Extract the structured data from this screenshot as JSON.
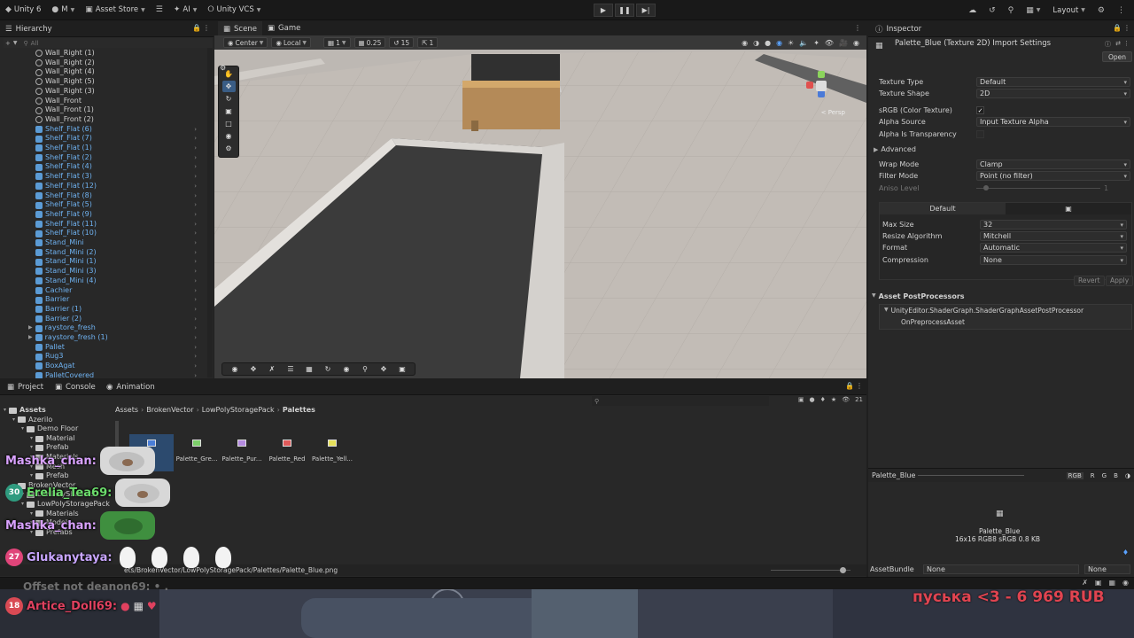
{
  "topbar": {
    "account": "Unity 6",
    "menu_m": "M",
    "asset_store": "Asset Store",
    "ai": "AI",
    "vcs": "Unity VCS",
    "layout": "Layout"
  },
  "hierarchy": {
    "tab": "Hierarchy",
    "search_placeholder": "All",
    "items": [
      {
        "label": "Wall_Right (1)",
        "kind": "grey"
      },
      {
        "label": "Wall_Right (2)",
        "kind": "grey"
      },
      {
        "label": "Wall_Right (4)",
        "kind": "grey"
      },
      {
        "label": "Wall_Right (5)",
        "kind": "grey"
      },
      {
        "label": "Wall_Right (3)",
        "kind": "grey"
      },
      {
        "label": "Wall_Front",
        "kind": "grey"
      },
      {
        "label": "Wall_Front (1)",
        "kind": "grey"
      },
      {
        "label": "Wall_Front (2)",
        "kind": "grey"
      },
      {
        "label": "Shelf_Flat (6)",
        "kind": "blue"
      },
      {
        "label": "Shelf_Flat (7)",
        "kind": "blue"
      },
      {
        "label": "Shelf_Flat (1)",
        "kind": "blue"
      },
      {
        "label": "Shelf_Flat (2)",
        "kind": "blue"
      },
      {
        "label": "Shelf_Flat (4)",
        "kind": "blue"
      },
      {
        "label": "Shelf_Flat (3)",
        "kind": "blue"
      },
      {
        "label": "Shelf_Flat (12)",
        "kind": "blue"
      },
      {
        "label": "Shelf_Flat (8)",
        "kind": "blue"
      },
      {
        "label": "Shelf_Flat (5)",
        "kind": "blue"
      },
      {
        "label": "Shelf_Flat (9)",
        "kind": "blue"
      },
      {
        "label": "Shelf_Flat (11)",
        "kind": "blue"
      },
      {
        "label": "Shelf_Flat (10)",
        "kind": "blue"
      },
      {
        "label": "Stand_Mini",
        "kind": "blue"
      },
      {
        "label": "Stand_Mini (2)",
        "kind": "blue"
      },
      {
        "label": "Stand_Mini (1)",
        "kind": "blue"
      },
      {
        "label": "Stand_Mini (3)",
        "kind": "blue"
      },
      {
        "label": "Stand_Mini (4)",
        "kind": "blue"
      },
      {
        "label": "Cachier",
        "kind": "blue"
      },
      {
        "label": "Barrier",
        "kind": "blue"
      },
      {
        "label": "Barrier (1)",
        "kind": "blue"
      },
      {
        "label": "Barrier (2)",
        "kind": "blue"
      },
      {
        "label": "raystore_fresh",
        "kind": "blue"
      },
      {
        "label": "raystore_fresh (1)",
        "kind": "blue"
      },
      {
        "label": "Pallet",
        "kind": "blue"
      },
      {
        "label": "Rug3",
        "kind": "blue"
      },
      {
        "label": "BoxAgat",
        "kind": "blue"
      },
      {
        "label": "PalletCovered",
        "kind": "blue"
      }
    ]
  },
  "scene": {
    "tab_scene": "Scene",
    "tab_game": "Game",
    "pivot": "Center",
    "space": "Local",
    "grid_value": "1",
    "snap_value": "0.25",
    "rot_snap": "15",
    "scale_snap": "1",
    "gizmo_label": "< Persp"
  },
  "inspector": {
    "tab": "Inspector",
    "title": "Palette_Blue (Texture 2D) Import Settings",
    "open_btn": "Open",
    "fields": {
      "texture_type": {
        "label": "Texture Type",
        "value": "Default"
      },
      "texture_shape": {
        "label": "Texture Shape",
        "value": "2D"
      },
      "srgb": {
        "label": "sRGB (Color Texture)",
        "checked": true
      },
      "alpha_source": {
        "label": "Alpha Source",
        "value": "Input Texture Alpha"
      },
      "alpha_transparency": {
        "label": "Alpha Is Transparency",
        "checked": false
      },
      "advanced": "Advanced",
      "wrap_mode": {
        "label": "Wrap Mode",
        "value": "Clamp"
      },
      "filter_mode": {
        "label": "Filter Mode",
        "value": "Point (no filter)"
      },
      "aniso": {
        "label": "Aniso Level",
        "value": "1"
      }
    },
    "platform": {
      "tab_default": "Default",
      "max_size": {
        "label": "Max Size",
        "value": "32"
      },
      "resize": {
        "label": "Resize Algorithm",
        "value": "Mitchell"
      },
      "format": {
        "label": "Format",
        "value": "Automatic"
      },
      "compression": {
        "label": "Compression",
        "value": "None"
      }
    },
    "revert": "Revert",
    "apply": "Apply",
    "postprocessors": {
      "title": "Asset PostProcessors",
      "line1": "UnityEditor.ShaderGraph.ShaderGraphAssetPostProcessor",
      "line2": "OnPreprocessAsset"
    },
    "preview": {
      "name": "Palette_Blue",
      "channels": [
        "RGB",
        "R",
        "G",
        "B"
      ],
      "caption_name": "Palette_Blue",
      "caption_info": "16x16  RGB8 sRGB  0.8 KB"
    },
    "assetbundle": {
      "label": "AssetBundle",
      "value": "None",
      "variant": "None"
    }
  },
  "project": {
    "tab_project": "Project",
    "tab_console": "Console",
    "tab_animation": "Animation",
    "breadcrumb": [
      "Assets",
      "BrokenVector",
      "LowPolyStoragePack",
      "Palettes"
    ],
    "count": "21",
    "tree": [
      {
        "label": "Assets",
        "depth": 0
      },
      {
        "label": "Azerilo",
        "depth": 1
      },
      {
        "label": "Demo Floor",
        "depth": 2
      },
      {
        "label": "Material",
        "depth": 3
      },
      {
        "label": "Prefab",
        "depth": 3
      },
      {
        "label": "Materials",
        "depth": 3
      },
      {
        "label": "Mesh",
        "depth": 3
      },
      {
        "label": "Prefab",
        "depth": 3
      },
      {
        "label": "BrokenVector",
        "depth": 1
      },
      {
        "label": "LowPolyShaders",
        "depth": 2
      },
      {
        "label": "LowPolyStoragePack",
        "depth": 2
      },
      {
        "label": "Materials",
        "depth": 3
      },
      {
        "label": "Models",
        "depth": 3
      },
      {
        "label": "Prefabs",
        "depth": 3
      }
    ],
    "assets": [
      {
        "name": "",
        "color": "#4a7ed8"
      },
      {
        "name": "Palette_Gre...",
        "color": "#7ccf6a"
      },
      {
        "name": "Palette_Pur...",
        "color": "#b48be0"
      },
      {
        "name": "Palette_Red",
        "color": "#e05a5a"
      },
      {
        "name": "Palette_Yell...",
        "color": "#e6e05a"
      }
    ],
    "path": "ets/BrokenVector/LowPolyStoragePack/Palettes/Palette_Blue.png"
  },
  "stream": {
    "chat": [
      {
        "user": "Mashka_chan:",
        "color": "#d9a2ff",
        "badge": ""
      },
      {
        "user": "Erelia_Tea69:",
        "color": "#6bdc6b",
        "badge": "30"
      },
      {
        "user": "Mashka_chan:",
        "color": "#d9a2ff",
        "badge": ""
      },
      {
        "user": "Glukanytaya:",
        "color": "#c9a6ff",
        "badge": "27"
      }
    ],
    "faded_line": "Offset not deanon69: • .",
    "bottom_user": "Artice_Doll69:",
    "bottom_badge": "18",
    "donation": "пуська <3 - 6 969 RUB"
  }
}
